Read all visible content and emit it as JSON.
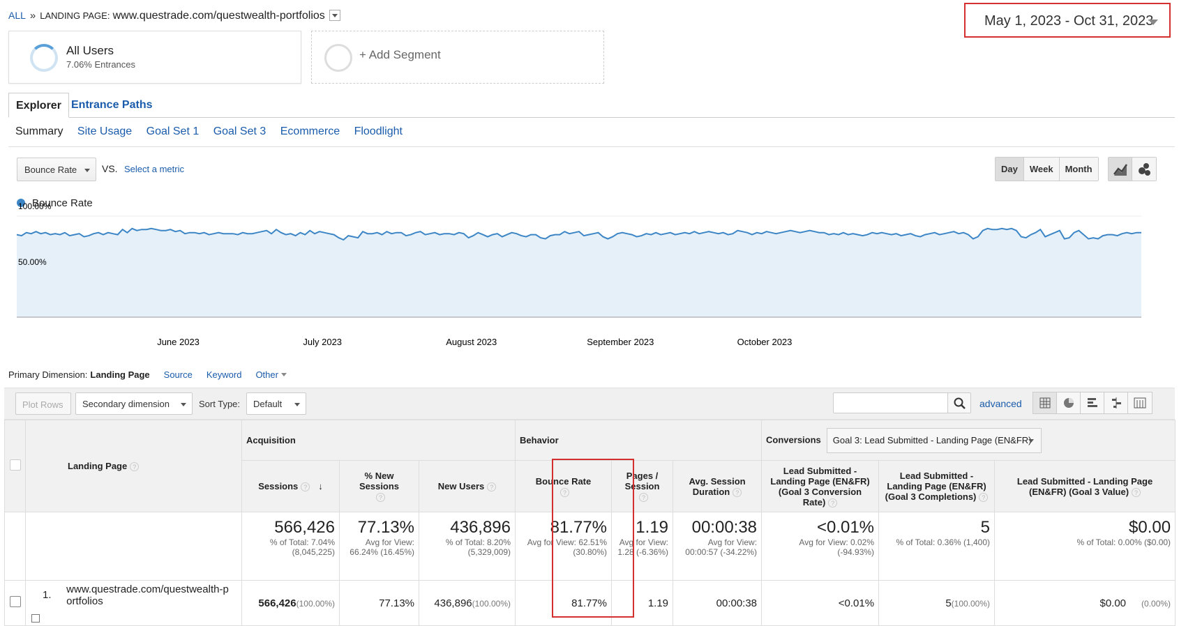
{
  "breadcrumb": {
    "all": "ALL",
    "separator": "»",
    "label": "LANDING PAGE:",
    "value": "www.questrade.com/questwealth-portfolios"
  },
  "date_range": "May 1, 2023 - Oct 31, 2023",
  "segments": [
    {
      "name": "All Users",
      "detail": "7.06% Entrances"
    },
    {
      "name": "+ Add Segment"
    }
  ],
  "tabs": [
    "Explorer",
    "Entrance Paths"
  ],
  "subtabs": [
    "Summary",
    "Site Usage",
    "Goal Set 1",
    "Goal Set 3",
    "Ecommerce",
    "Floodlight"
  ],
  "metric_selector": {
    "metric": "Bounce Rate",
    "vs": "VS.",
    "select": "Select a metric"
  },
  "granularity": [
    "Day",
    "Week",
    "Month"
  ],
  "granularity_selected": "Day",
  "chart_data": {
    "type": "area",
    "series": [
      {
        "name": "Bounce Rate",
        "color": "#3d86c6",
        "values": [
          82,
          81,
          84,
          83,
          85,
          83,
          84,
          82,
          83,
          82,
          84,
          81,
          82,
          83,
          80,
          81,
          83,
          84,
          82,
          84,
          83,
          82,
          87,
          84,
          88,
          86,
          87,
          87,
          88,
          87,
          86,
          86,
          87,
          85,
          86,
          83,
          84,
          84,
          83,
          84,
          82,
          83,
          84,
          83,
          83,
          83,
          82,
          84,
          83,
          83,
          84,
          85,
          86,
          83,
          87,
          84,
          82,
          83,
          81,
          84,
          82,
          86,
          83,
          85,
          84,
          83,
          82,
          79,
          77,
          81,
          80,
          79,
          85,
          83,
          83,
          84,
          82,
          85,
          83,
          84,
          84,
          81,
          82,
          84,
          85,
          82,
          83,
          84,
          82,
          83,
          83,
          82,
          84,
          83,
          79,
          81,
          84,
          82,
          80,
          82,
          83,
          80,
          82,
          84,
          83,
          81,
          80,
          82,
          82,
          79,
          78,
          81,
          82,
          82,
          85,
          83,
          84,
          85,
          81,
          82,
          83,
          84,
          80,
          78,
          80,
          83,
          84,
          83,
          82,
          80,
          81,
          83,
          82,
          84,
          82,
          83,
          84,
          82,
          83,
          84,
          83,
          85,
          83,
          84,
          85,
          84,
          83,
          84,
          82,
          83,
          86,
          85,
          84,
          82,
          84,
          83,
          85,
          84,
          83,
          84,
          85,
          86,
          85,
          84,
          85,
          86,
          85,
          84,
          84,
          82,
          83,
          82,
          84,
          82,
          83,
          82,
          81,
          82,
          84,
          83,
          84,
          83,
          82,
          83,
          81,
          82,
          83,
          81,
          80,
          82,
          83,
          84,
          82,
          83,
          84,
          85,
          83,
          84,
          82,
          78,
          80,
          86,
          88,
          87,
          87,
          88,
          87,
          88,
          86,
          80,
          79,
          82,
          84,
          87,
          80,
          82,
          84,
          86,
          78,
          79,
          84,
          86,
          82,
          78,
          79,
          78,
          81,
          82,
          82,
          81,
          83,
          84,
          83,
          84,
          84
        ]
      }
    ],
    "y_ticks": [
      "100.00%",
      "50.00%"
    ],
    "ylim": [
      0,
      100
    ],
    "x_ticks": [
      "June 2023",
      "July 2023",
      "August 2023",
      "September 2023",
      "October 2023"
    ],
    "grid": true
  },
  "primary_dimension": {
    "label": "Primary Dimension:",
    "current": "Landing Page",
    "options": [
      "Source",
      "Keyword",
      "Other"
    ]
  },
  "toolbar": {
    "plot_rows": "Plot Rows",
    "secondary": "Secondary dimension",
    "sort_label": "Sort Type:",
    "sort_value": "Default",
    "advanced": "advanced"
  },
  "table": {
    "group_headers": {
      "acquisition": "Acquisition",
      "behavior": "Behavior",
      "conversions": "Conversions",
      "goal_select": "Goal 3: Lead Submitted - Landing Page (EN&FR)"
    },
    "columns": {
      "landing_page": "Landing Page",
      "sessions": "Sessions",
      "new_sessions": "% New Sessions",
      "new_users": "New Users",
      "bounce_rate": "Bounce Rate",
      "pages_session": "Pages / Session",
      "avg_duration": "Avg. Session Duration",
      "conv_rate": "Lead Submitted - Landing Page (EN&FR) (Goal 3 Conversion Rate)",
      "completions": "Lead Submitted - Landing Page (EN&FR) (Goal 3 Completions)",
      "value": "Lead Submitted - Landing Page (EN&FR) (Goal 3 Value)"
    },
    "totals": {
      "sessions": {
        "big": "566,426",
        "sub": "% of Total: 7.04% (8,045,225)"
      },
      "new_sessions": {
        "big": "77.13%",
        "sub": "Avg for View: 66.24% (16.45%)"
      },
      "new_users": {
        "big": "436,896",
        "sub": "% of Total: 8.20% (5,329,009)"
      },
      "bounce_rate": {
        "big": "81.77%",
        "sub": "Avg for View: 62.51% (30.80%)"
      },
      "pages_session": {
        "big": "1.19",
        "sub": "Avg for View: 1.28 (-6.36%)"
      },
      "avg_duration": {
        "big": "00:00:38",
        "sub": "Avg for View: 00:00:57 (-34.22%)"
      },
      "conv_rate": {
        "big": "<0.01%",
        "sub": "Avg for View: 0.02% (-94.93%)"
      },
      "completions": {
        "big": "5",
        "sub": "% of Total: 0.36% (1,400)"
      },
      "value": {
        "big": "$0.00",
        "sub": "% of Total: 0.00% ($0.00)"
      }
    },
    "rows": [
      {
        "index": "1.",
        "page": "www.questrade.com/questwealth-portfolios",
        "sessions": "566,426",
        "sessions_pct": "(100.00%)",
        "new_sessions": "77.13%",
        "new_users": "436,896",
        "new_users_pct": "(100.00%)",
        "bounce_rate": "81.77%",
        "pages_session": "1.19",
        "avg_duration": "00:00:38",
        "conv_rate": "<0.01%",
        "completions": "5",
        "completions_pct": "(100.00%)",
        "value": "$0.00",
        "value_pct": "(0.00%)"
      }
    ]
  },
  "colors": {
    "link": "#1a5cab",
    "highlight": "#d32f2f",
    "series": "#3d86c6"
  }
}
